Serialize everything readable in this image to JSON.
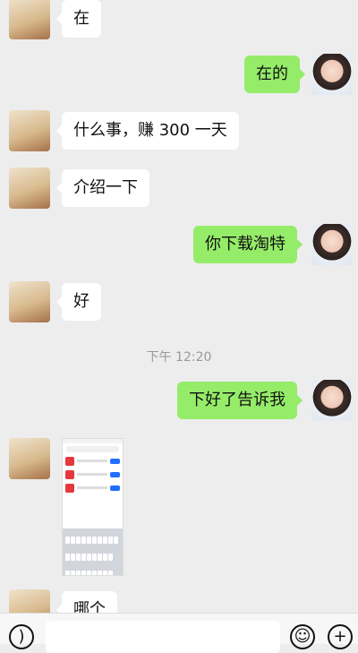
{
  "chat": {
    "messages": [
      {
        "id": "m1",
        "sender": "contact",
        "text": "在"
      },
      {
        "id": "m2",
        "sender": "me",
        "text": "在的"
      },
      {
        "id": "m3",
        "sender": "contact",
        "text": "什么事，赚 300 一天"
      },
      {
        "id": "m4",
        "sender": "contact",
        "text": "介绍一下"
      },
      {
        "id": "m5",
        "sender": "me",
        "text": "你下载淘特"
      },
      {
        "id": "m6",
        "sender": "contact",
        "text": "好"
      },
      {
        "id": "m7",
        "sender": "me",
        "text": "下好了告诉我"
      },
      {
        "id": "m8",
        "sender": "contact",
        "type": "image"
      },
      {
        "id": "m9",
        "sender": "contact",
        "text": "哪个"
      }
    ],
    "timestamp": "下午 12:20"
  },
  "input_bar": {
    "voice_icon": "voice-icon",
    "emoji_icon": "emoji-icon",
    "plus_icon": "plus-icon",
    "input_value": ""
  },
  "colors": {
    "background": "#ededed",
    "incoming_bubble": "#ffffff",
    "outgoing_bubble": "#95ec69",
    "timestamp_text": "#999999"
  }
}
